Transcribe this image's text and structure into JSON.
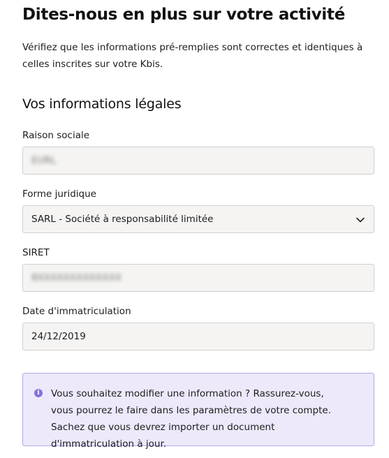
{
  "header": {
    "title": "Dites-nous en plus sur votre activité",
    "intro": "Vérifiez que les informations pré-remplies sont correctes et identiques à celles inscrites sur votre Kbis."
  },
  "legal": {
    "section_title": "Vos informations légales",
    "raison_sociale": {
      "label": "Raison sociale",
      "value": "EURL"
    },
    "forme_juridique": {
      "label": "Forme juridique",
      "value": "SARL - Société à responsabilité limitée",
      "icon": "chevron-down-icon"
    },
    "siret": {
      "label": "SIRET",
      "value": "8XXXXXXXXXXXXX"
    },
    "date_immatriculation": {
      "label": "Date d'immatriculation",
      "value": "24/12/2019"
    }
  },
  "info": {
    "icon": "info-icon",
    "text": "Vous souhaitez modifier une information ? Rassurez-vous, vous pourrez le faire dans les paramètres de votre compte. Sachez que vous devrez importer un document d'immatriculation à jour."
  },
  "colors": {
    "field_background": "#f5f4f3",
    "field_border": "#cfcfcf",
    "info_background": "#ede9fb",
    "info_border": "#b3a6e8",
    "info_icon": "#8a6fe0"
  }
}
